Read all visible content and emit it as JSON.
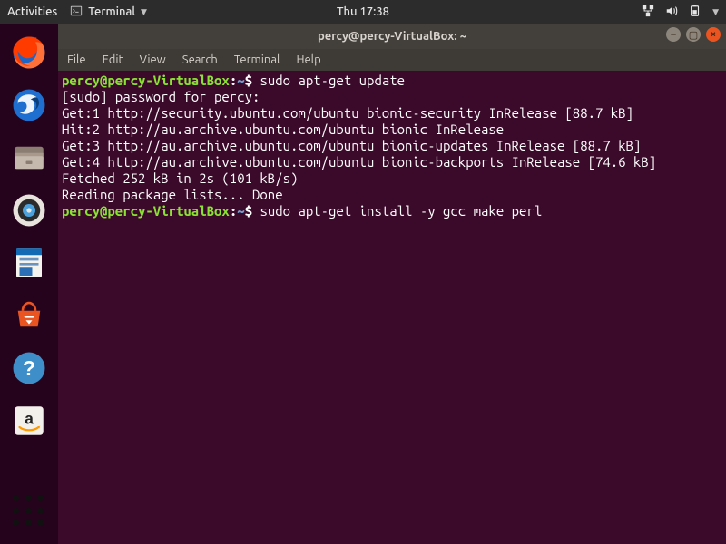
{
  "panel": {
    "activities_label": "Activities",
    "app_name": "Terminal",
    "clock": "Thu 17:38"
  },
  "launcher": {
    "items": [
      {
        "name": "firefox-icon"
      },
      {
        "name": "thunderbird-icon"
      },
      {
        "name": "files-icon"
      },
      {
        "name": "rhythmbox-icon"
      },
      {
        "name": "writer-icon"
      },
      {
        "name": "software-icon"
      },
      {
        "name": "help-icon"
      },
      {
        "name": "amazon-icon"
      }
    ],
    "apps_button": "show-applications"
  },
  "window": {
    "title": "percy@percy-VirtualBox: ~",
    "menubar": [
      "File",
      "Edit",
      "View",
      "Search",
      "Terminal",
      "Help"
    ]
  },
  "terminal": {
    "prompt_user": "percy@percy-VirtualBox",
    "prompt_sep": ":",
    "prompt_path": "~",
    "prompt_dollar": "$",
    "lines": [
      {
        "type": "prompt",
        "cmd": "sudo apt-get update"
      },
      {
        "type": "out",
        "text": "[sudo] password for percy:"
      },
      {
        "type": "out",
        "text": "Get:1 http://security.ubuntu.com/ubuntu bionic-security InRelease [88.7 kB]"
      },
      {
        "type": "out",
        "text": "Hit:2 http://au.archive.ubuntu.com/ubuntu bionic InRelease"
      },
      {
        "type": "out",
        "text": "Get:3 http://au.archive.ubuntu.com/ubuntu bionic-updates InRelease [88.7 kB]"
      },
      {
        "type": "out",
        "text": "Get:4 http://au.archive.ubuntu.com/ubuntu bionic-backports InRelease [74.6 kB]"
      },
      {
        "type": "out",
        "text": "Fetched 252 kB in 2s (101 kB/s)"
      },
      {
        "type": "out",
        "text": "Reading package lists... Done"
      },
      {
        "type": "prompt",
        "cmd": "sudo apt-get install -y gcc make perl"
      }
    ]
  }
}
